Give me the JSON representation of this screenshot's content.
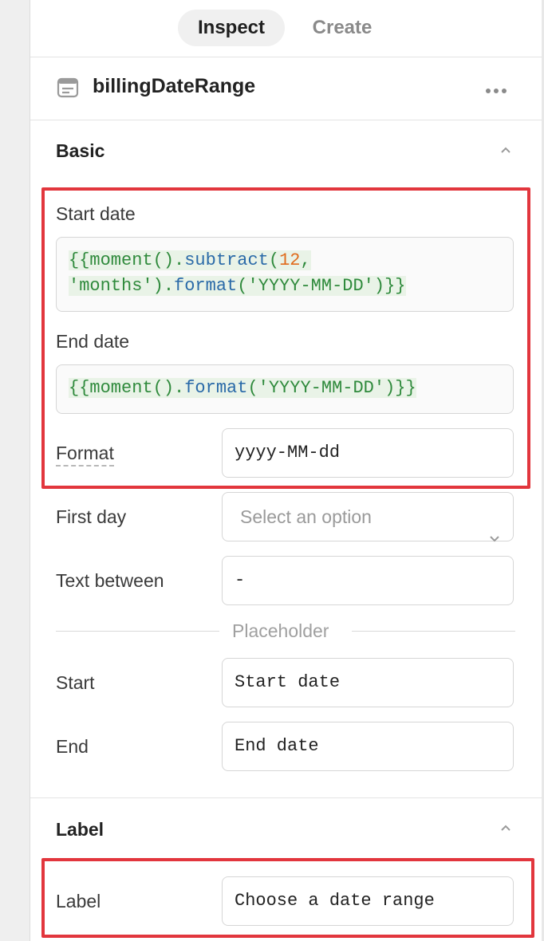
{
  "tabs": {
    "inspect": "Inspect",
    "create": "Create"
  },
  "component": {
    "name": "billingDateRange",
    "icon": "date-range-icon",
    "menu_icon": "more-horizontal-icon"
  },
  "basic": {
    "title": "Basic",
    "start_date": {
      "label": "Start date",
      "line1": {
        "open": "{{",
        "obj": "moment()",
        "dot": ".",
        "fn": "subtract",
        "paren": "(",
        "num": "12",
        "comma": ","
      },
      "line2": {
        "str": "'months'",
        "close": ")",
        "dot": ".",
        "fn": "format",
        "paren": "(",
        "fmt": "'YYYY-MM-DD'",
        "end": ")}}"
      }
    },
    "end_date": {
      "label": "End date",
      "code": {
        "open": "{{",
        "obj": "moment()",
        "dot": ".",
        "fn": "format",
        "paren": "(",
        "fmt": "'YYYY-MM-DD'",
        "end": ")}}"
      }
    },
    "format": {
      "label": "Format",
      "value": "yyyy-MM-dd"
    },
    "first_day": {
      "label": "First day",
      "placeholder": "Select an option"
    },
    "text_between": {
      "label": "Text between",
      "value": "-"
    },
    "placeholder_divider": "Placeholder",
    "start": {
      "label": "Start",
      "value": "Start date"
    },
    "end": {
      "label": "End",
      "value": "End date"
    }
  },
  "label_section": {
    "title": "Label",
    "label": {
      "label": "Label",
      "value": "Choose a date range"
    }
  },
  "colors": {
    "highlight": "#e2363d",
    "template_green": "#2f8a3c",
    "function_blue": "#2a6aa8",
    "number_orange": "#e06b1c"
  }
}
